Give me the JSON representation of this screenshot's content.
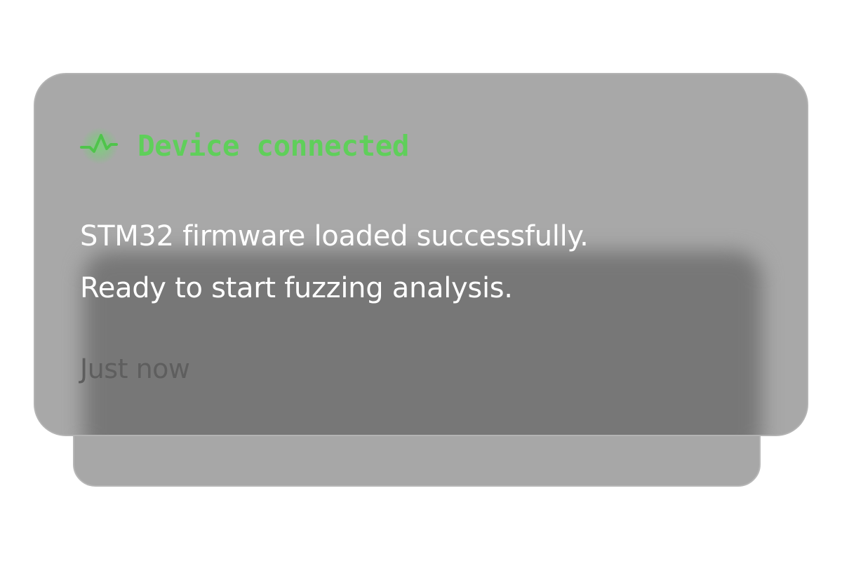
{
  "notification": {
    "icon": "pulse-icon",
    "title": "Device connected",
    "message_lines": [
      "STM32 firmware loaded successfully.",
      "Ready to start fuzzing analysis."
    ],
    "timestamp": "Just now"
  },
  "colors": {
    "accent_green": "#5fcf5a",
    "card_background": "#a8a8a8",
    "message_text": "#ffffff",
    "timestamp_text": "#5e5e5e"
  }
}
